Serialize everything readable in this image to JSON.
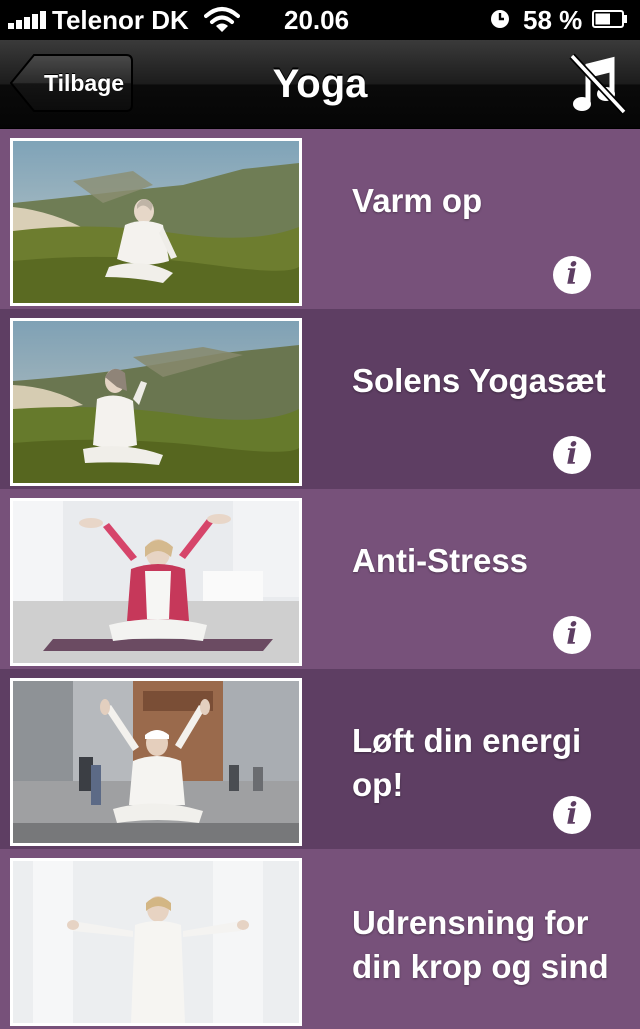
{
  "status_bar": {
    "carrier": "Telenor DK",
    "time": "20.06",
    "battery_percent": "58 %",
    "battery_level": 0.58,
    "signal_icon": "signal-bars-icon",
    "wifi_icon": "wifi-icon",
    "alarm_icon": "clock-icon",
    "battery_icon": "battery-icon"
  },
  "nav": {
    "back_label": "Tilbage",
    "title": "Yoga",
    "mute_icon": "music-off-icon"
  },
  "info_glyph": "i",
  "items": [
    {
      "title": "Varm op",
      "image": "photo-woman-seated-on-grassy-dune-by-sea",
      "info_icon": "info-icon"
    },
    {
      "title": "Solens Yogasæt",
      "image": "photo-woman-seated-on-grass-by-sea",
      "info_icon": "info-icon"
    },
    {
      "title": "Anti-Stress",
      "image": "photo-woman-cross-legged-arms-raised-on-mat",
      "info_icon": "info-icon"
    },
    {
      "title": "Løft din energi op!",
      "image": "photo-woman-in-white-arms-raised-city-square",
      "info_icon": "info-icon"
    },
    {
      "title": "Udrensning for din krop og sind",
      "image": "photo-woman-arms-outstretched-white-room",
      "info_icon": "info-icon"
    }
  ],
  "colors": {
    "row_light": "#77517a",
    "row_dark": "#5e3e63",
    "navbar": "#1c1c1c",
    "text": "#ffffff"
  }
}
